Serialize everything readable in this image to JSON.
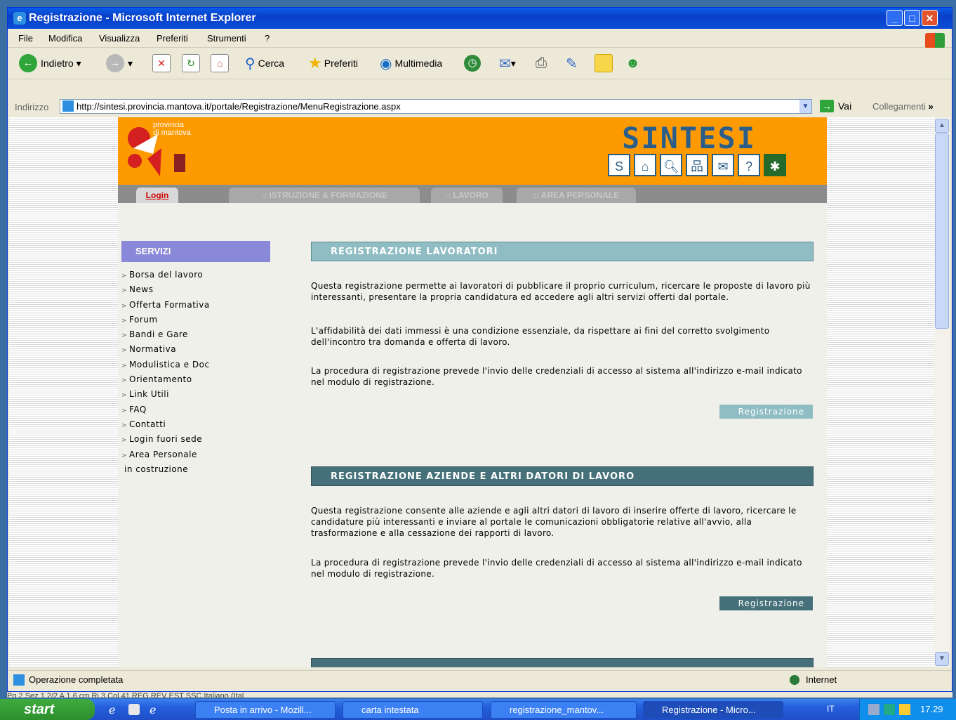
{
  "window": {
    "title": "Registrazione - Microsoft Internet Explorer"
  },
  "menubar": [
    "File",
    "Modifica",
    "Visualizza",
    "Preferiti",
    "Strumenti",
    "?"
  ],
  "toolbar": {
    "back": "Indietro",
    "search": "Cerca",
    "favorites": "Preferiti",
    "media": "Multimedia"
  },
  "address": {
    "label": "Indirizzo",
    "url": "http://sintesi.provincia.mantova.it/portale/Registrazione/MenuRegistrazione.aspx",
    "go": "Vai",
    "links": "Collegamenti"
  },
  "site": {
    "logo_line1": "provincia",
    "logo_line2": "di mantova",
    "brand": "SINTESI",
    "nav": [
      "Login",
      ":: ISTRUZIONE & FORMAZIONE",
      ":: LAVORO",
      ":: AREA PERSONALE"
    ]
  },
  "sidebar": {
    "title": "SERVIZI",
    "items": [
      "Borsa del lavoro",
      "News",
      "Offerta Formativa",
      "Forum",
      "Bandi e Gare",
      "Normativa",
      "Modulistica e Doc",
      "Orientamento",
      "Link Utili",
      "FAQ",
      "Contatti",
      "Login fuori sede",
      "Area Personale"
    ],
    "note": "in costruzione"
  },
  "sections": [
    {
      "title": "REGISTRAZIONE LAVORATORI",
      "p1": "Questa registrazione permette ai lavoratori di pubblicare il proprio curriculum, ricercare le proposte di lavoro più interessanti, presentare la propria candidatura ed accedere agli altri servizi offerti dal portale.",
      "p2": "L'affidabilità dei dati immessi è una condizione essenziale, da rispettare ai fini del corretto svolgimento dell'incontro tra domanda e offerta di lavoro.",
      "p3": "La procedura di registrazione prevede l'invio delle credenziali di accesso al sistema all'indirizzo e-mail indicato nel modulo di registrazione.",
      "button": "Registrazione"
    },
    {
      "title": "REGISTRAZIONE AZIENDE E ALTRI DATORI DI LAVORO",
      "p1": "Questa registrazione consente alle aziende e agli altri datori di lavoro di inserire offerte di lavoro, ricercare le candidature più interessanti e inviare al portale le comunicazioni obbligatorie relative all'avvio, alla trasformazione e alla cessazione dei rapporti di lavoro.",
      "p2": "La procedura di registrazione prevede l'invio delle credenziali di accesso al sistema all'indirizzo e-mail indicato nel modulo di registrazione.",
      "button": "Registrazione"
    }
  ],
  "status": {
    "text": "Operazione completata",
    "zone": "Internet"
  },
  "behind_status": "Pg 2   Sez 1   2/2   A 1,6 cm   Ri 3   Col 41   REG  REV  EST  SSC  Italiano (Ital",
  "taskbar": {
    "start": "start",
    "tasks": [
      "Posta in arrivo - Mozill...",
      "carta intestata",
      "registrazione_mantov...",
      "Registrazione - Micro..."
    ],
    "lang": "IT",
    "clock": "17.29"
  },
  "colors": {
    "banner": "#fd9a00",
    "brand": "#2c5d86",
    "teal": "#8fbdc3",
    "dark_teal": "#46717a",
    "sidebar_head": "#8a88d8"
  }
}
